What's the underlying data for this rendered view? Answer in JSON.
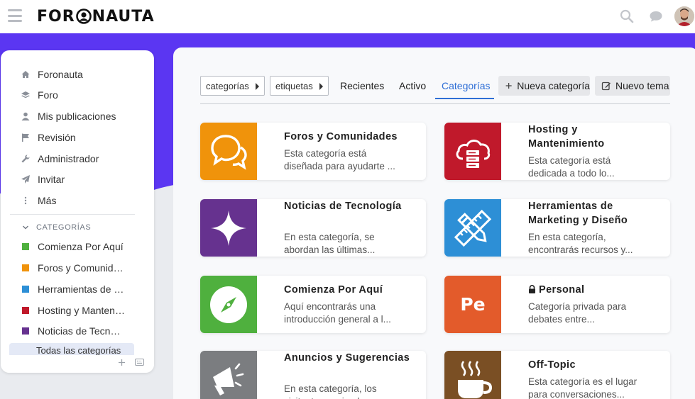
{
  "header": {
    "logo_text_left": "FOR",
    "logo_text_right": "NAUTA",
    "icons": [
      "menu-icon",
      "search-icon",
      "chat-icon",
      "user-avatar"
    ]
  },
  "sidebar": {
    "nav": [
      {
        "label": "Foronauta",
        "icon": "home-icon"
      },
      {
        "label": "Foro",
        "icon": "layers-icon"
      },
      {
        "label": "Mis publicaciones",
        "icon": "user-icon"
      },
      {
        "label": "Revisión",
        "icon": "flag-icon"
      },
      {
        "label": "Administrador",
        "icon": "wrench-icon"
      },
      {
        "label": "Invitar",
        "icon": "paper-plane-icon"
      },
      {
        "label": "Más",
        "icon": "vertical-dots-icon"
      }
    ],
    "categories_heading": "CATEGORÍAS",
    "categories": [
      {
        "label": "Comienza Por Aquí",
        "color": "#4fb03e"
      },
      {
        "label": "Foros y Comunidades",
        "color": "#f0930b"
      },
      {
        "label": "Herramientas de Marketing y Diseño",
        "color": "#2d8fd6"
      },
      {
        "label": "Hosting y Mantenimiento",
        "color": "#c0192b"
      },
      {
        "label": "Noticias de Tecnología",
        "color": "#66328f"
      }
    ],
    "partial_item": "Todas las categorías"
  },
  "toolbar": {
    "dropdown_categories": "categorías",
    "dropdown_tags": "etiquetas",
    "tabs": [
      "Recientes",
      "Activo",
      "Categorías"
    ],
    "active_tab": "Categorías",
    "new_category": "Nueva categoría",
    "new_topic": "Nuevo tema"
  },
  "cards": [
    {
      "title": "Foros y Comunidades",
      "desc": "Esta categoría está diseñada para ayudarte ...",
      "color": "#f0930b",
      "icon": "chat-bubbles-icon"
    },
    {
      "title": "Hosting y Mantenimiento",
      "desc": "Esta categoría está dedicada a todo lo...",
      "color": "#c0192b",
      "icon": "cloud-server-icon"
    },
    {
      "title": "Noticias de Tecnología",
      "desc": "En esta categoría, se abordan las últimas...",
      "color": "#66328f",
      "icon": "sparkle-icon"
    },
    {
      "title": "Herramientas de Marketing y Diseño",
      "desc": "En esta categoría, encontrarás recursos y...",
      "color": "#2d8fd6",
      "icon": "ruler-pencil-icon"
    },
    {
      "title": "Comienza Por Aquí",
      "desc": "Aquí encontrarás una introducción general a l...",
      "color": "#4fb03e",
      "icon": "compass-icon"
    },
    {
      "title": "Personal",
      "desc": "Categoría privada para debates entre...",
      "color": "#e35b2b",
      "icon": "lock-icon",
      "badge_text": "Pe"
    },
    {
      "title": "Anuncios y Sugerencias",
      "desc": "En esta categoría, los visitantes y miembros...",
      "color": "#7b7d80",
      "icon": "megaphone-icon"
    },
    {
      "title": "Off-Topic",
      "desc": "Esta categoría es el lugar para conversaciones...",
      "color": "#7a4f24",
      "icon": "coffee-cup-icon"
    }
  ]
}
